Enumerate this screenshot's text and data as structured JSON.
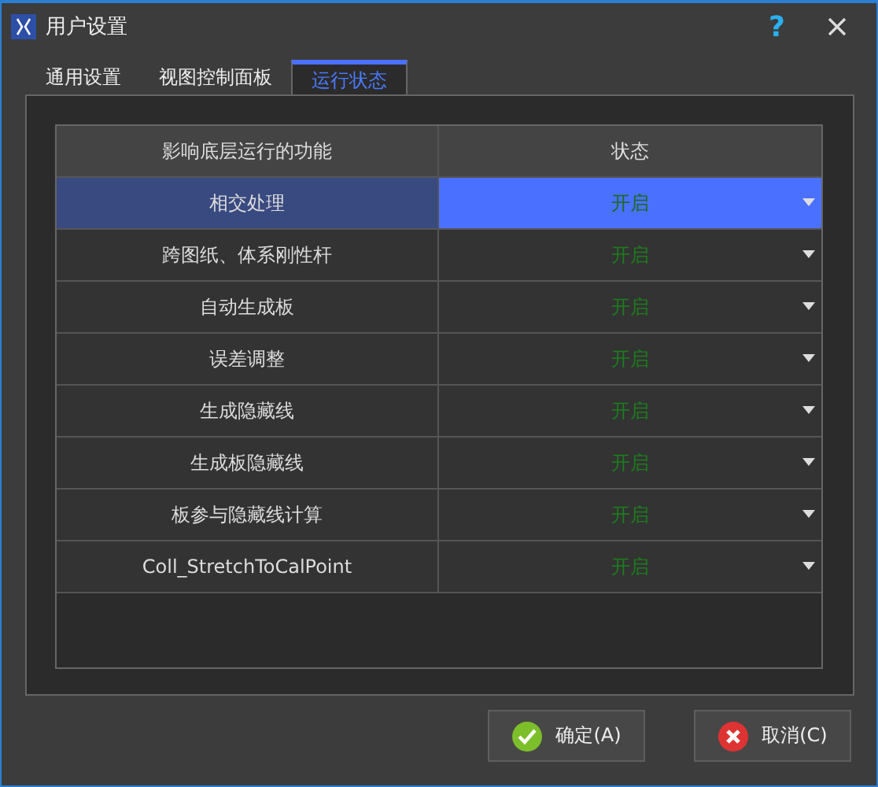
{
  "window": {
    "title": "用户设置",
    "help": "?"
  },
  "tabs": [
    {
      "label": "通用设置",
      "selected": false
    },
    {
      "label": "视图控制面板",
      "selected": false
    },
    {
      "label": "运行状态",
      "selected": true
    }
  ],
  "table": {
    "columns": [
      "影响底层运行的功能",
      "状态"
    ],
    "rows": [
      {
        "feature": "相交处理",
        "status": "开启",
        "selected": true
      },
      {
        "feature": "跨图纸、体系刚性杆",
        "status": "开启",
        "selected": false
      },
      {
        "feature": "自动生成板",
        "status": "开启",
        "selected": false
      },
      {
        "feature": "误差调整",
        "status": "开启",
        "selected": false
      },
      {
        "feature": "生成隐藏线",
        "status": "开启",
        "selected": false
      },
      {
        "feature": "生成板隐藏线",
        "status": "开启",
        "selected": false
      },
      {
        "feature": "板参与隐藏线计算",
        "status": "开启",
        "selected": false
      },
      {
        "feature": "Coll_StretchToCalPoint",
        "status": "开启",
        "selected": false
      }
    ]
  },
  "buttons": [
    {
      "label": "确定(A)",
      "kind": "ok"
    },
    {
      "label": "取消(C)",
      "kind": "cancel"
    }
  ]
}
